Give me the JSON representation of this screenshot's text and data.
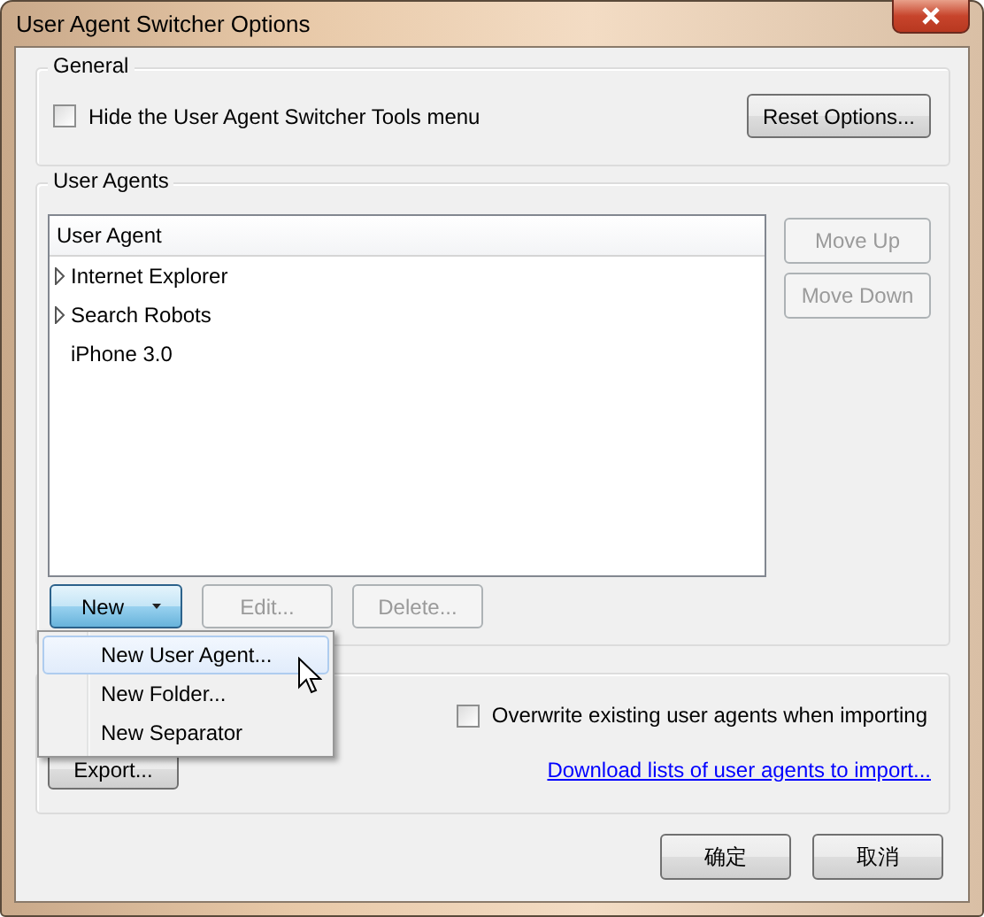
{
  "window": {
    "title": "User Agent Switcher Options"
  },
  "general": {
    "legend": "General",
    "hide_menu": {
      "label": "Hide the User Agent Switcher Tools menu",
      "checked": false
    },
    "reset_button": "Reset Options..."
  },
  "user_agents": {
    "legend": "User Agents",
    "column": "User Agent",
    "items": [
      {
        "label": "Internet Explorer",
        "kind": "folder",
        "expanded": false
      },
      {
        "label": "Search Robots",
        "kind": "folder",
        "expanded": false
      },
      {
        "label": "iPhone 3.0",
        "kind": "agent"
      }
    ],
    "side_buttons": [
      {
        "label": "Move Up",
        "disabled": true
      },
      {
        "label": "Move Down",
        "disabled": true
      }
    ],
    "new_button": {
      "label": "New",
      "open": true
    },
    "buttons": [
      {
        "label": "Edit...",
        "disabled": true
      },
      {
        "label": "Delete...",
        "disabled": true
      }
    ],
    "new_menu": [
      {
        "label": "New User Agent...",
        "selected": true
      },
      {
        "label": "New Folder...",
        "selected": false
      },
      {
        "label": "New Separator",
        "selected": false
      }
    ]
  },
  "import": {
    "overwrite": {
      "label": "Overwrite existing user agents when importing",
      "checked": false
    },
    "export_button": "Export...",
    "link": "Download lists of user agents to import..."
  },
  "footer": [
    {
      "label": "确定"
    },
    {
      "label": "取消"
    }
  ]
}
